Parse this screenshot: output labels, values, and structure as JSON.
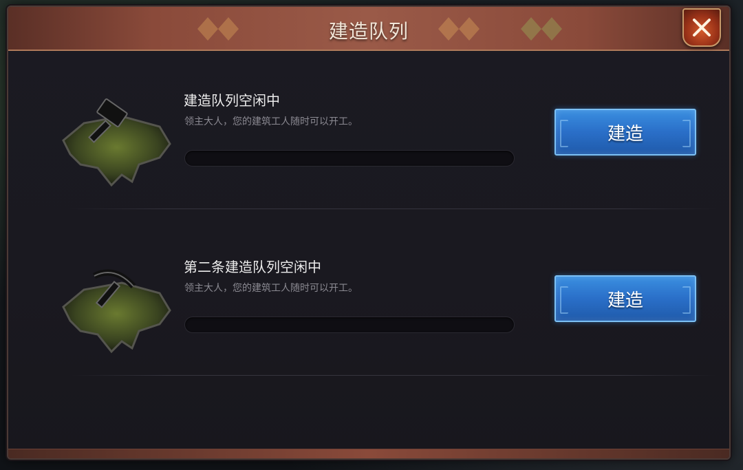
{
  "dialog": {
    "title": "建造队列",
    "close_icon": "close-x-icon"
  },
  "queues": [
    {
      "title": "建造队列空闲中",
      "description": "领主大人，您的建筑工人随时可以开工。",
      "progress": 0,
      "tool_icon": "hammer-icon",
      "button_label": "建造"
    },
    {
      "title": "第二条建造队列空闲中",
      "description": "领主大人，您的建筑工人随时可以开工。",
      "progress": 0,
      "tool_icon": "pickaxe-icon",
      "button_label": "建造"
    }
  ],
  "colors": {
    "accent_button": "#2a6fc8",
    "title_bar": "#8a4a3a",
    "close_button": "#d25a2a"
  }
}
